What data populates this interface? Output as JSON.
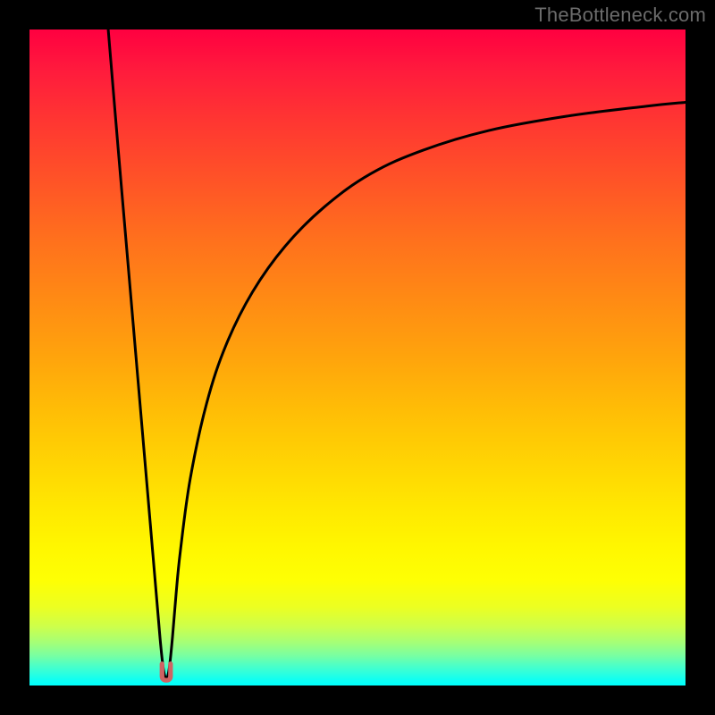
{
  "watermark": "TheBottleneck.com",
  "colors": {
    "frame": "#000000",
    "curve_stroke": "#000000",
    "marker_fill": "#cf6363",
    "watermark_text": "#6b6b6b"
  },
  "chart_data": {
    "type": "line",
    "title": "",
    "xlabel": "",
    "ylabel": "",
    "xlim": [
      0,
      100
    ],
    "ylim": [
      0,
      100
    ],
    "grid": false,
    "legend": false,
    "series": [
      {
        "name": "bottleneck-curve",
        "x": [
          12.0,
          13.5,
          15.0,
          16.5,
          18.0,
          19.1,
          19.9,
          20.4,
          20.85,
          21.3,
          21.8,
          22.35,
          23.0,
          24.5,
          27.0,
          30.0,
          34.0,
          39.0,
          45.0,
          52.0,
          60.0,
          70.0,
          82.0,
          94.0,
          100.0
        ],
        "y": [
          100.0,
          82.0,
          64.5,
          47.0,
          29.5,
          16.6,
          7.2,
          2.6,
          1.1,
          2.6,
          7.4,
          14.0,
          20.5,
          31.5,
          43.0,
          52.0,
          60.0,
          67.0,
          73.0,
          78.0,
          81.6,
          84.6,
          86.8,
          88.3,
          88.9
        ]
      }
    ],
    "marker": {
      "x_range": [
        20.2,
        21.5
      ],
      "y_range": [
        0.8,
        3.3
      ],
      "shape": "u"
    },
    "background_gradient": {
      "orientation": "vertical",
      "stops": [
        {
          "pos": 0.0,
          "color": "#ff0040"
        },
        {
          "pos": 0.5,
          "color": "#ffa40c"
        },
        {
          "pos": 0.79,
          "color": "#fff700"
        },
        {
          "pos": 1.0,
          "color": "#00fffc"
        }
      ]
    }
  }
}
